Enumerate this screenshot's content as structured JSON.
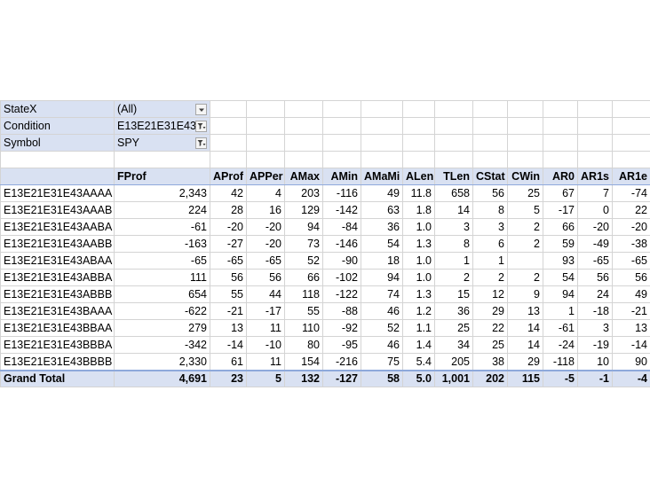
{
  "filters": [
    {
      "label": "StateX",
      "value": "(All)",
      "icon": "dropdown-arrow-icon"
    },
    {
      "label": "Condition",
      "value": "E13E21E31E43",
      "icon": "filter-icon"
    },
    {
      "label": "Symbol",
      "value": "SPY",
      "icon": "filter-icon"
    }
  ],
  "columns": [
    "FProf",
    "AProf",
    "APPer",
    "AMax",
    "AMin",
    "AMaMi",
    "ALen",
    "TLen",
    "CStat",
    "CWin",
    "AR0",
    "AR1s",
    "AR1e"
  ],
  "rows": [
    {
      "label": "E13E21E31E43AAAA",
      "values": [
        "2,343",
        "42",
        "4",
        "203",
        "-116",
        "49",
        "11.8",
        "658",
        "56",
        "25",
        "67",
        "7",
        "-74"
      ]
    },
    {
      "label": "E13E21E31E43AAAB",
      "values": [
        "224",
        "28",
        "16",
        "129",
        "-142",
        "63",
        "1.8",
        "14",
        "8",
        "5",
        "-17",
        "0",
        "22"
      ]
    },
    {
      "label": "E13E21E31E43AABA",
      "values": [
        "-61",
        "-20",
        "-20",
        "94",
        "-84",
        "36",
        "1.0",
        "3",
        "3",
        "2",
        "66",
        "-20",
        "-20"
      ]
    },
    {
      "label": "E13E21E31E43AABB",
      "values": [
        "-163",
        "-27",
        "-20",
        "73",
        "-146",
        "54",
        "1.3",
        "8",
        "6",
        "2",
        "59",
        "-49",
        "-38"
      ]
    },
    {
      "label": "E13E21E31E43ABAA",
      "values": [
        "-65",
        "-65",
        "-65",
        "52",
        "-90",
        "18",
        "1.0",
        "1",
        "1",
        "",
        "93",
        "-65",
        "-65"
      ]
    },
    {
      "label": "E13E21E31E43ABBA",
      "values": [
        "111",
        "56",
        "56",
        "66",
        "-102",
        "94",
        "1.0",
        "2",
        "2",
        "2",
        "54",
        "56",
        "56"
      ]
    },
    {
      "label": "E13E21E31E43ABBB",
      "values": [
        "654",
        "55",
        "44",
        "118",
        "-122",
        "74",
        "1.3",
        "15",
        "12",
        "9",
        "94",
        "24",
        "49"
      ]
    },
    {
      "label": "E13E21E31E43BAAA",
      "values": [
        "-622",
        "-21",
        "-17",
        "55",
        "-88",
        "46",
        "1.2",
        "36",
        "29",
        "13",
        "1",
        "-18",
        "-21"
      ]
    },
    {
      "label": "E13E21E31E43BBAA",
      "values": [
        "279",
        "13",
        "11",
        "110",
        "-92",
        "52",
        "1.1",
        "25",
        "22",
        "14",
        "-61",
        "3",
        "13"
      ]
    },
    {
      "label": "E13E21E31E43BBBA",
      "values": [
        "-342",
        "-14",
        "-10",
        "80",
        "-95",
        "46",
        "1.4",
        "34",
        "25",
        "14",
        "-24",
        "-19",
        "-14"
      ]
    },
    {
      "label": "E13E21E31E43BBBB",
      "values": [
        "2,330",
        "61",
        "11",
        "154",
        "-216",
        "75",
        "5.4",
        "205",
        "38",
        "29",
        "-118",
        "10",
        "90"
      ]
    }
  ],
  "total": {
    "label": "Grand Total",
    "values": [
      "4,691",
      "23",
      "5",
      "132",
      "-127",
      "58",
      "5.0",
      "1,001",
      "202",
      "115",
      "-5",
      "-1",
      "-4"
    ]
  },
  "colors": {
    "pivot_fill": "#d9e1f2",
    "grid": "#d4d4d4",
    "border_accent": "#8ea9db"
  }
}
